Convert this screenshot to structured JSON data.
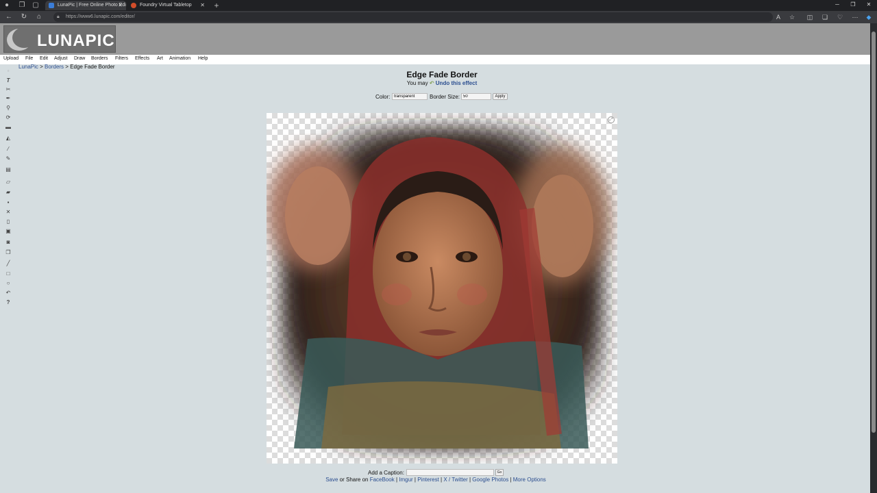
{
  "browser": {
    "tabs": [
      {
        "title": "LunaPic | Free Online Photo Edit",
        "active": true,
        "fav_color": "#3b7dd8"
      },
      {
        "title": "Foundry Virtual Tabletop",
        "active": false,
        "fav_color": "#d24d2a"
      }
    ],
    "url": "https://www6.lunapic.com/editor/"
  },
  "logo": {
    "text": "LUNAPIC"
  },
  "menu": [
    "Upload",
    "File",
    "Edit",
    "Adjust",
    "Draw",
    "Borders",
    "Filters",
    "Effects",
    "Art",
    "Animation",
    "Help"
  ],
  "breadcrumb": {
    "root": "LunaPic",
    "sep1": " > ",
    "section": "Borders",
    "sep2": " > ",
    "current": "Edge Fade Border"
  },
  "effect": {
    "title": "Edge Fade Border",
    "undo_prefix": "You may",
    "undo_link": "Undo this effect"
  },
  "controls": {
    "color_label": "Color:",
    "color_value": "transparent",
    "size_label": "Border Size:",
    "size_value": "50",
    "apply_label": "Apply"
  },
  "caption": {
    "label": "Add a Caption:",
    "go_label": "Go"
  },
  "share": {
    "save": "Save",
    "or_share": " or Share on ",
    "links": [
      "FaceBook",
      "Imgur",
      "Pinterest",
      "X / Twitter",
      "Google Photos",
      "More Options"
    ],
    "sep": " | "
  },
  "icons": [
    "menu-icon",
    "text-icon",
    "scissors-icon",
    "pen-icon",
    "zoom-icon",
    "rotate-icon",
    "crop-icon",
    "fill-icon",
    "brush-icon",
    "pencil-icon",
    "layers-icon",
    "eraser-icon",
    "open-icon",
    "save-icon",
    "close-icon",
    "new-icon",
    "print-icon",
    "copy-icon",
    "duplicate-icon",
    "line-icon",
    "rectangle-icon",
    "circle-icon",
    "undo-icon",
    "help-icon"
  ]
}
